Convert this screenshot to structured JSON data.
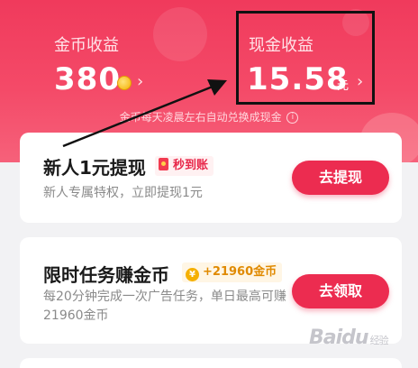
{
  "earnings": {
    "coin_label": "金币收益",
    "coin_value": "380",
    "cash_label": "现金收益",
    "cash_value": "15.58",
    "cash_unit": "元",
    "chevron": "›"
  },
  "notice": "金币每天凌晨左右自动兑换成现金",
  "tasks": [
    {
      "title": "新人1元提现",
      "badge": "秒到账",
      "description": "新人专属特权，立即提现1元",
      "button": "去提现"
    },
    {
      "title": "限时任务赚金币",
      "badge": "+21960金币",
      "description": "每20分钟完成一次广告任务，单日最高可赚21960金币",
      "button": "去领取"
    }
  ],
  "watermark": {
    "logo": "Baidu",
    "sub": "经验"
  },
  "colors": {
    "header": "#f03a5c",
    "button": "#ec2c50",
    "coin": "#f5b000"
  },
  "icons": [
    "coin-icon",
    "chevron-right-icon",
    "info-icon",
    "red-packet-icon",
    "yen-coin-icon"
  ]
}
